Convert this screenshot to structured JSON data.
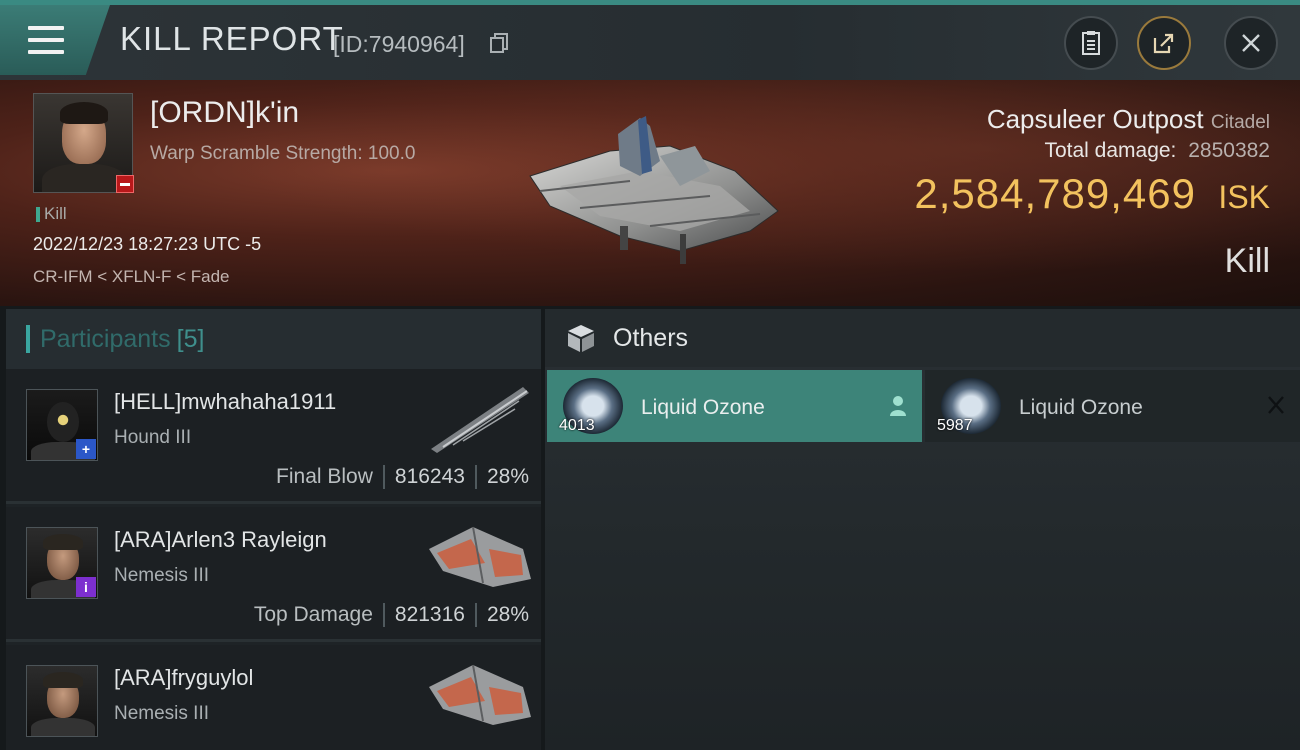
{
  "header": {
    "title": "KILL REPORT",
    "id_label": "[ID:7940964]",
    "icons": [
      "menu-icon",
      "copy-icon",
      "clipboard-icon",
      "share-icon",
      "close-icon"
    ]
  },
  "victim": {
    "name": "[ORDN]k'in",
    "subtitle": "Warp Scramble Strength: 100.0",
    "status_tag": "Kill",
    "time": "2022/12/23 18:27:23 UTC -5",
    "location": "CR-IFM < XFLN-F < Fade"
  },
  "target": {
    "name": "Capsuleer Outpost",
    "class": "Citadel",
    "total_damage_label": "Total damage:",
    "total_damage_value": "2850382",
    "isk_value": "2,584,789,469",
    "isk_unit": "ISK",
    "result": "Kill"
  },
  "participants": {
    "label": "Participants",
    "count": "[5]",
    "rows": [
      {
        "name": "[HELL]mwhahaha1911",
        "ship": "Hound III",
        "role": "Final Blow",
        "damage": "816243",
        "percent": "28%"
      },
      {
        "name": "[ARA]Arlen3 Rayleign",
        "ship": "Nemesis III",
        "role": "Top Damage",
        "damage": "821316",
        "percent": "28%"
      },
      {
        "name": "[ARA]fryguylol",
        "ship": "Nemesis III",
        "role": "",
        "damage": "",
        "percent": ""
      }
    ]
  },
  "others": {
    "label": "Others",
    "items": [
      {
        "name": "Liquid Ozone",
        "quantity": "4013",
        "selected": true
      },
      {
        "name": "Liquid Ozone",
        "quantity": "5987",
        "selected": false
      }
    ]
  },
  "colors": {
    "accent": "#3d8479",
    "isk": "#f3c25e",
    "banner": "#4e2219"
  }
}
